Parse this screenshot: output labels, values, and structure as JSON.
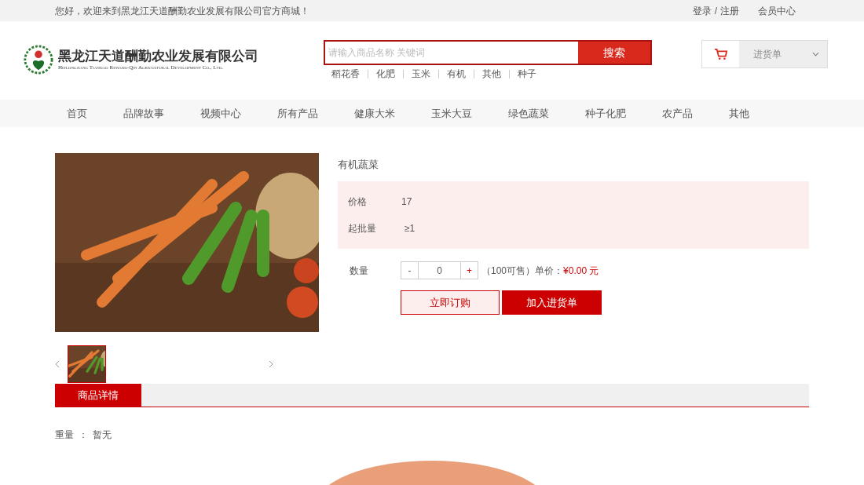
{
  "top_bar": {
    "welcome": "您好，欢迎来到黑龙江天道酬勤农业发展有限公司官方商城！",
    "login": "登录",
    "separator": "/",
    "register": "注册",
    "member_center": "会员中心"
  },
  "logo": {
    "name": "黑龙江天道酬勤农业发展有限公司",
    "subtitle": "Heilongjiang Tiandao Reward-Qin Agricultural Development Co., Ltd."
  },
  "search": {
    "placeholder": "请输入商品名称 关键词",
    "button": "搜索",
    "hot_words": [
      "稻花香",
      "化肥",
      "玉米",
      "有机",
      "其他",
      "种子"
    ]
  },
  "cart": {
    "label": "进货单"
  },
  "nav": [
    {
      "label": "首页",
      "selected": false
    },
    {
      "label": "品牌故事",
      "selected": false
    },
    {
      "label": "视频中心",
      "selected": false
    },
    {
      "label": "所有产品",
      "selected": false
    },
    {
      "label": "健康大米",
      "selected": false
    },
    {
      "label": "玉米大豆",
      "selected": false
    },
    {
      "label": "绿色蔬菜",
      "selected": false
    },
    {
      "label": "种子化肥",
      "selected": false
    },
    {
      "label": "农产品",
      "selected": false
    },
    {
      "label": "其他",
      "selected": false
    }
  ],
  "gallery": {
    "thumbnails": [
      {
        "selected": true
      }
    ]
  },
  "product": {
    "title": "有机蔬菜",
    "price_label": "价格",
    "price": "17",
    "min_label": "起批量",
    "min": "≥1",
    "qty_label": "数量",
    "minus": "-",
    "qty": "0",
    "plus": "+",
    "stock": "（100可售）",
    "unit_label": "单价：",
    "unit_price": "¥0.00 元",
    "buy_now": "立即订购",
    "add_cart": "加入进货单"
  },
  "detail_tabs": [
    {
      "label": "商品详情",
      "selected": true
    }
  ],
  "detail": {
    "weight_label": "重量",
    "colon": "：",
    "weight": "暂无"
  }
}
